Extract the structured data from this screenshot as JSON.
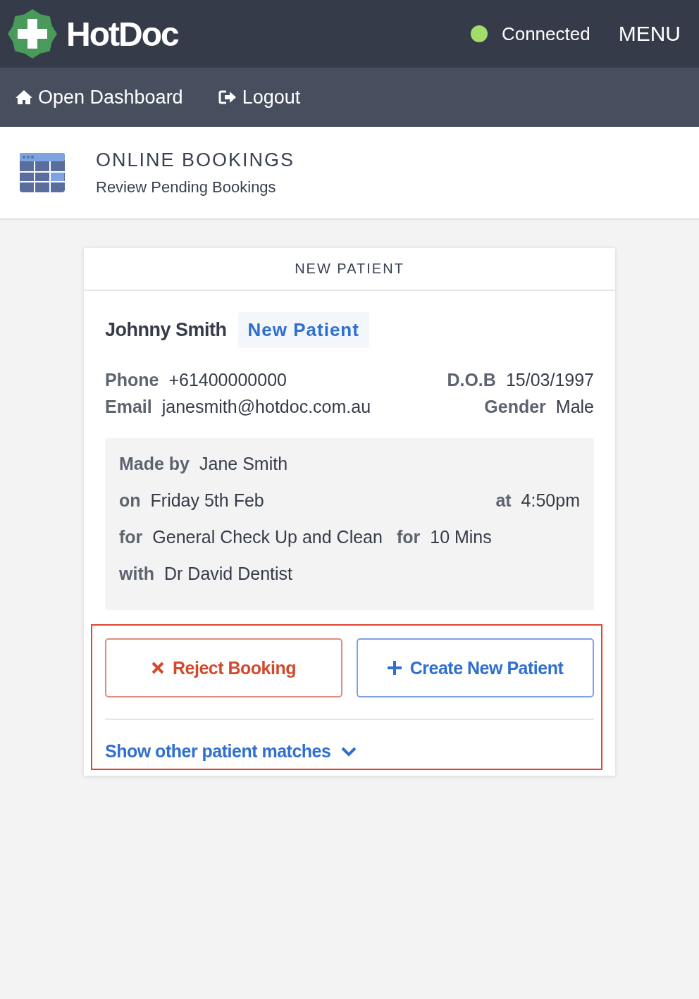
{
  "app": {
    "name": "HotDoc"
  },
  "connection": {
    "label": "Connected",
    "connected": true
  },
  "menu": {
    "label": "MENU"
  },
  "nav": [
    {
      "label": "Open Dashboard",
      "kind": "home"
    },
    {
      "label": "Logout",
      "kind": "logout"
    }
  ],
  "page_header": {
    "title": "ONLINE BOOKINGS",
    "subtitle": "Review Pending Bookings"
  },
  "card": {
    "title": "NEW PATIENT",
    "patient": {
      "name": "Johnny Smith",
      "badge": "New Patient"
    },
    "details_left": [
      {
        "label": "Phone",
        "value": "+61400000000"
      },
      {
        "label": "Email",
        "value": "janesmith@hotdoc.com.au"
      }
    ],
    "details_right": [
      {
        "label": "D.O.B",
        "value": "15/03/1997"
      },
      {
        "label": "Gender",
        "value": "Male"
      }
    ],
    "booking": [
      [
        {
          "label": "Made by",
          "value": "Jane Smith",
          "kind": "inline"
        }
      ],
      [
        {
          "label": "on",
          "value": "Friday 5th Feb",
          "kind": "inline"
        },
        {
          "label": "at",
          "value": "4:50pm",
          "kind": "end"
        }
      ],
      [
        {
          "label": "for",
          "value": "General Check Up and Clean",
          "kind": "inline"
        },
        {
          "label": "for",
          "value": "10 Mins",
          "kind": "inline"
        }
      ],
      [
        {
          "label": "with",
          "value": "Dr David Dentist",
          "kind": "inline"
        }
      ]
    ],
    "highlighted": true,
    "actions": [
      {
        "label": "Reject Booking",
        "kind": "reject"
      },
      {
        "label": "Create New Patient",
        "kind": "create"
      }
    ],
    "more_link": {
      "label": "Show other patient matches",
      "expanded": false
    }
  }
}
